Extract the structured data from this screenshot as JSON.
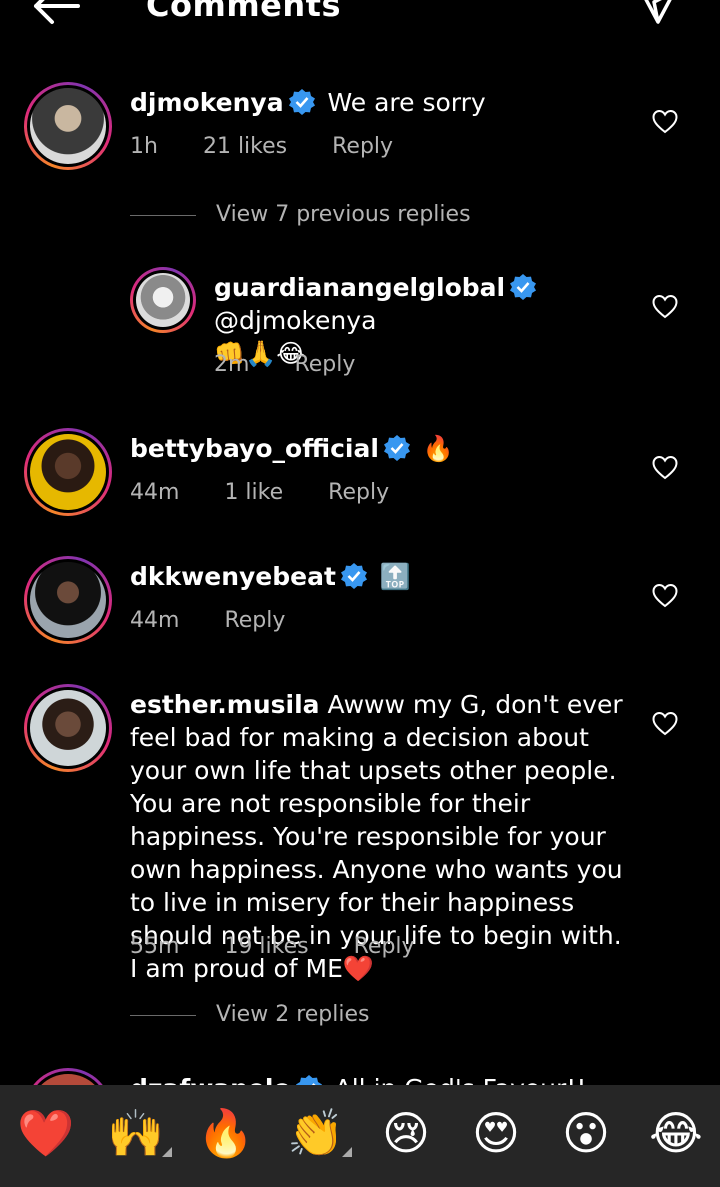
{
  "header": {
    "title": "Comments"
  },
  "comments": [
    {
      "username": "djmokenya",
      "text": "We are sorry",
      "time": "1h",
      "likes": "21 likes",
      "reply": "Reply",
      "view_replies": "View 7 previous replies"
    },
    {
      "username": "guardianangelglobal",
      "mention": "@djmokenya",
      "emoji": "👊🙏😂",
      "time": "2m",
      "reply": "Reply"
    },
    {
      "username": "bettybayo_official",
      "emoji": "🔥",
      "time": "44m",
      "likes": "1 like",
      "reply": "Reply"
    },
    {
      "username": "dkkwenyebeat",
      "emoji": "🔝",
      "time": "44m",
      "reply": "Reply"
    },
    {
      "username": "esther.musila",
      "text": "Awww my G, don't ever feel bad for making a decision about your own life that upsets other people. You are not responsible for their happiness. You're responsible for your own happiness. Anyone who wants you to live in misery for their happiness should not be in your life to begin with. I am proud of ME❤️",
      "time": "55m",
      "likes": "19 likes",
      "reply": "Reply",
      "view_replies": "View 2 replies"
    },
    {
      "username": "dzafwanelo",
      "text": "All in God's Favour!!"
    }
  ],
  "reactions": [
    "❤️",
    "🙌",
    "🔥",
    "👏",
    "😢",
    "😍",
    "😮",
    "😂"
  ],
  "colors": {
    "verified": "#3897f0",
    "background": "#000000",
    "bar": "#262626"
  }
}
